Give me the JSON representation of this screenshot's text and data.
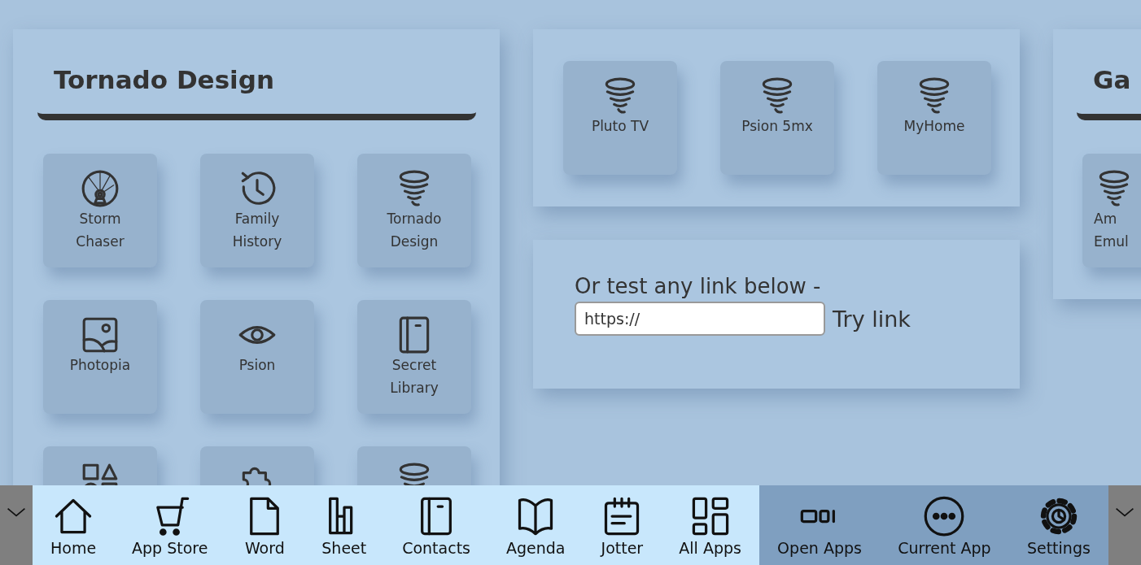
{
  "panels": [
    {
      "title": "Tornado Design",
      "apps": [
        {
          "label": "Storm\nChaser",
          "kind": "wheel"
        },
        {
          "label": "Family\nHistory",
          "kind": "history"
        },
        {
          "label": "Tornado\nDesign",
          "kind": "tornado"
        },
        {
          "label": "Photopia",
          "kind": "image"
        },
        {
          "label": "Psion",
          "kind": "eye"
        },
        {
          "label": "Secret\nLibrary",
          "kind": "notebook"
        },
        {
          "kind": "shapes"
        },
        {
          "kind": "puzzle"
        },
        {
          "kind": "tornado"
        }
      ]
    }
  ],
  "top_panel": {
    "apps": [
      {
        "label": "Pluto TV",
        "kind": "tornado"
      },
      {
        "label": "Psion 5mx",
        "kind": "tornado"
      },
      {
        "label": "MyHome",
        "kind": "tornado"
      }
    ]
  },
  "link_panel": {
    "prompt": "Or test any link below -",
    "url_field": {
      "value": "https://"
    },
    "button": "Try link"
  },
  "right_panel": {
    "title": "Ga",
    "apps": [
      {
        "label": "Am\nEmul",
        "kind": "tornado"
      }
    ]
  },
  "taskbar": {
    "apps": [
      {
        "label": "Home",
        "kind": "home"
      },
      {
        "label": "App Store",
        "kind": "cart"
      },
      {
        "label": "Word",
        "kind": "document"
      },
      {
        "label": "Sheet",
        "kind": "chart"
      },
      {
        "label": "Contacts",
        "kind": "notebook"
      },
      {
        "label": "Agenda",
        "kind": "book"
      },
      {
        "label": "Jotter",
        "kind": "jotter"
      },
      {
        "label": "All Apps",
        "kind": "grid"
      }
    ],
    "system": [
      {
        "label": "Open Apps",
        "kind": "windows"
      },
      {
        "label": "Current App",
        "kind": "dots"
      },
      {
        "label": "Settings",
        "kind": "gear"
      }
    ]
  }
}
